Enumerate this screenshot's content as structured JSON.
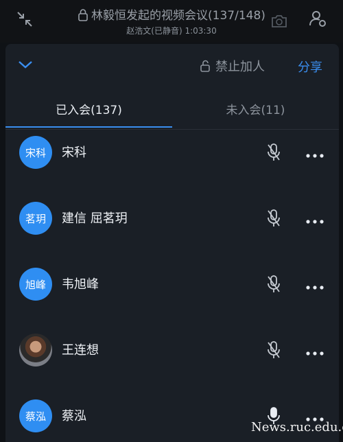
{
  "header": {
    "title": "林毅恒发起的视频会议(137/148)",
    "subtitle": "赵浩文(已静音) 1:03:30"
  },
  "panel": {
    "lock_join_label": "禁止加人",
    "share_label": "分享",
    "tabs": [
      {
        "label": "已入会(137)",
        "active": true
      },
      {
        "label": "未入会(11)",
        "active": false
      }
    ],
    "participants": [
      {
        "avatar_text": "宋科",
        "name": "宋科",
        "avatar_type": "initials",
        "mic": "muted"
      },
      {
        "avatar_text": "茗玥",
        "name": "建信 屈茗玥",
        "avatar_type": "initials",
        "mic": "muted"
      },
      {
        "avatar_text": "旭峰",
        "name": "韦旭峰",
        "avatar_type": "initials",
        "mic": "muted"
      },
      {
        "avatar_text": "",
        "name": "王连想",
        "avatar_type": "photo",
        "mic": "muted"
      },
      {
        "avatar_text": "蔡泓",
        "name": "蔡泓",
        "avatar_type": "initials",
        "mic": "on"
      }
    ]
  },
  "watermark": "News.ruc.edu.cn",
  "colors": {
    "accent": "#3a8ef0",
    "avatar_bg": "#2f8ef2",
    "panel_bg": "#1a1f26"
  }
}
